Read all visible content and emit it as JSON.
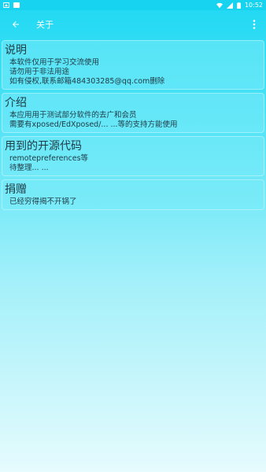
{
  "status_bar": {
    "time": "10:52",
    "left_icons": [
      "image-notification-icon",
      "x-notification-icon"
    ],
    "right_icons": [
      "wifi-icon",
      "signal-icon",
      "battery-icon"
    ]
  },
  "app_bar": {
    "title": "关于",
    "back_icon": "back-arrow-icon",
    "more_icon": "more-vert-icon"
  },
  "cards": [
    {
      "title": "说明",
      "lines": [
        "本软件仅用于学习交流使用",
        "请勿用于非法用途",
        "如有侵权,联系邮箱484303285@qq.com删除"
      ]
    },
    {
      "title": "介绍",
      "lines": [
        "本应用用于测试部分软件的去广和会员",
        "需要有xposed/EdXposed/... ...等的支持方能使用"
      ]
    },
    {
      "title": "用到的开源代码",
      "lines": [
        "remotepreferences等",
        "待整理... ..."
      ]
    },
    {
      "title": "捐赠",
      "lines": [
        "已经穷得揭不开锅了"
      ]
    }
  ]
}
